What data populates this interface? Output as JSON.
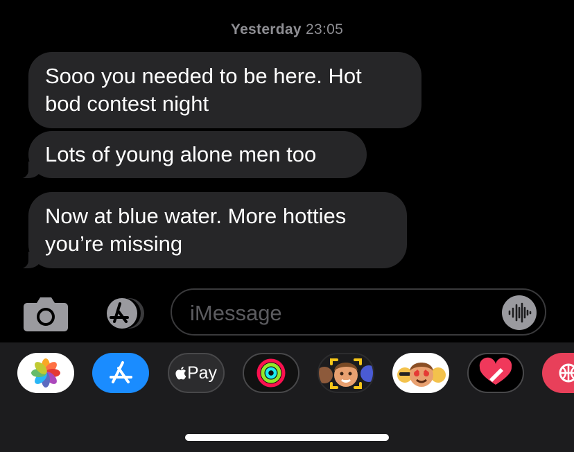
{
  "thread": {
    "timestamp_day": "Yesterday",
    "timestamp_time": "23:05",
    "messages": [
      {
        "text": "Sooo you needed to be here.  Hot\nbod contest night"
      },
      {
        "text": "Lots of young alone men too"
      },
      {
        "text": "Now at blue water.  More hotties\nyou’re missing"
      }
    ]
  },
  "composer": {
    "placeholder": "iMessage",
    "icons": {
      "camera": "camera-icon",
      "apps": "app-store-icon",
      "audio": "waveform-icon"
    }
  },
  "app_drawer": {
    "apple_pay_label": "Pay",
    "apps": [
      "photos-icon",
      "app-store-icon",
      "apple-pay-icon",
      "activity-icon",
      "memoji-icon",
      "memoji-stickers-icon",
      "digital-touch-icon",
      "web-icon"
    ]
  },
  "colors": {
    "background": "#000000",
    "bubble_received": "#262628",
    "drawer": "#1c1c1e",
    "app_store_blue": "#1a8cff"
  }
}
